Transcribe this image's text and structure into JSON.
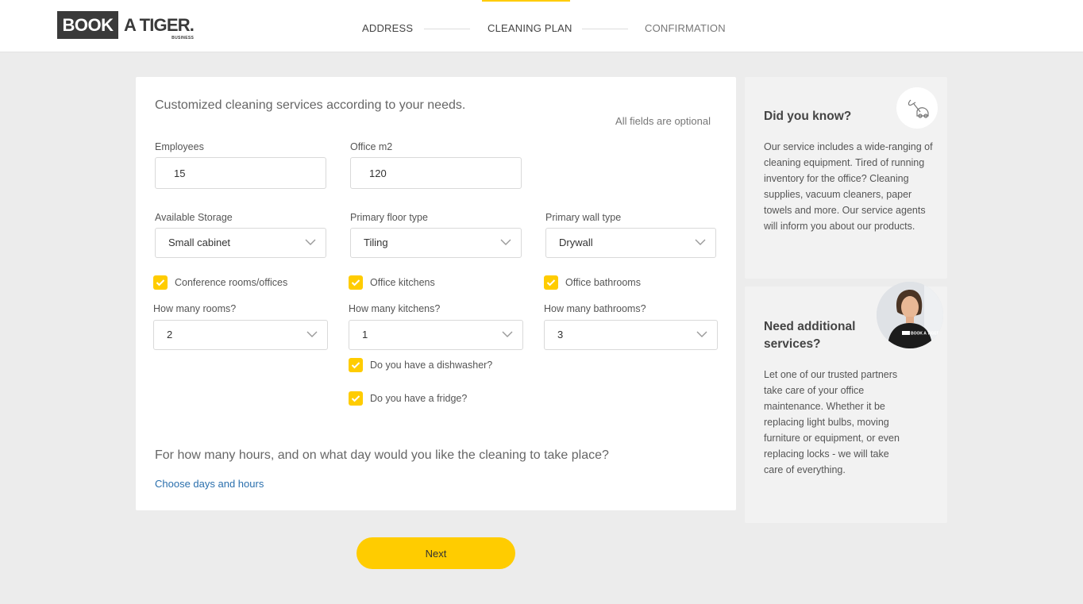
{
  "header": {
    "logo": {
      "book": "BOOK",
      "tiger": "A TIGER.",
      "business": "BUSINESS"
    },
    "steps": [
      {
        "label": "ADDRESS",
        "state": "done"
      },
      {
        "label": "CLEANING PLAN",
        "state": "active"
      },
      {
        "label": "CONFIRMATION",
        "state": "upcoming"
      }
    ]
  },
  "form": {
    "intro": "Customized cleaning services according to your needs.",
    "optional_note": "All fields are optional",
    "employees": {
      "label": "Employees",
      "value": "15"
    },
    "office_m2": {
      "label": "Office m2",
      "value": "120"
    },
    "storage": {
      "label": "Available Storage",
      "value": "Small cabinet"
    },
    "floor": {
      "label": "Primary floor type",
      "value": "Tiling"
    },
    "wall": {
      "label": "Primary wall type",
      "value": "Drywall"
    },
    "rooms": {
      "check_label": "Conference rooms/offices",
      "checked": true,
      "count_label": "How many rooms?",
      "count_value": "2"
    },
    "kitchens": {
      "check_label": "Office kitchens",
      "checked": true,
      "count_label": "How many kitchens?",
      "count_value": "1"
    },
    "bathrooms": {
      "check_label": "Office bathrooms",
      "checked": true,
      "count_label": "How many bathrooms?",
      "count_value": "3"
    },
    "dishwasher": {
      "label": "Do you have a dishwasher?",
      "checked": true
    },
    "fridge": {
      "label": "Do you have a fridge?",
      "checked": true
    },
    "schedule_question": "For how many hours, and on what day would you like the cleaning to take place?",
    "schedule_link": "Choose days and hours",
    "next_label": "Next"
  },
  "sidebar": {
    "did_you_know": {
      "title": "Did you know?",
      "text": "Our service includes a wide-ranging of cleaning equipment. Tired of running inventory for the office? Cleaning supplies, vacuum cleaners, paper towels and more. Our service agents will inform you about our products.",
      "icon": "vacuum-cleaner-icon"
    },
    "additional": {
      "title": "Need additional services?",
      "text": "Let one of our trusted partners take care of your office maintenance. Whether it be replacing light bulbs, moving furniture or equipment, or even replacing locks - we will take care of everything.",
      "shirt_text": "BOOK A TIGER"
    }
  },
  "colors": {
    "accent": "#ffcc00",
    "link": "#2a6fad",
    "background": "#ececec",
    "dark": "#3a3a3a"
  }
}
